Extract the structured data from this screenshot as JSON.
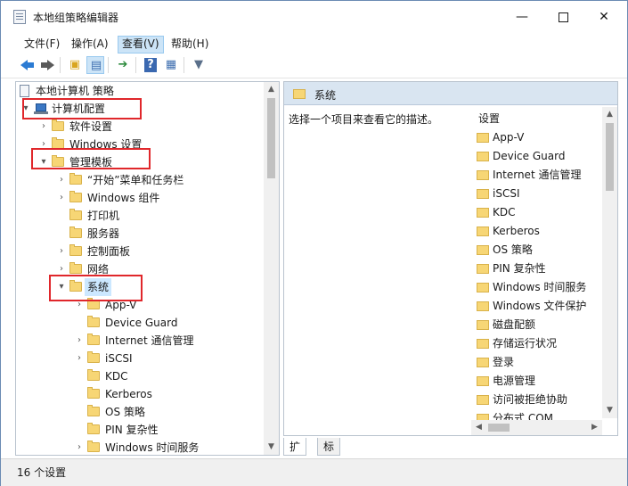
{
  "window": {
    "title": "本地组策略编辑器",
    "min_glyph": "—",
    "close_glyph": "✕"
  },
  "menu": [
    {
      "label": "文件(F)"
    },
    {
      "label": "操作(A)"
    },
    {
      "label": "查看(V)"
    },
    {
      "label": "帮助(H)"
    }
  ],
  "toolbar": {
    "icons": [
      "back-icon",
      "forward-icon",
      "up-folder-icon",
      "show-hide-tree-icon",
      "export-list-icon",
      "help-icon",
      "properties-icon",
      "filter-icon"
    ]
  },
  "tree": {
    "root": "本地计算机 策略",
    "computer_config": "计算机配置",
    "software_settings": "软件设置",
    "windows_settings": "Windows 设置",
    "admin_templates": "管理模板",
    "start_menu": "“开始”菜单和任务栏",
    "windows_components": "Windows 组件",
    "printers": "打印机",
    "server": "服务器",
    "control_panel": "控制面板",
    "network": "网络",
    "system": "系统",
    "children": [
      {
        "label": "App-V",
        "expandable": true
      },
      {
        "label": "Device Guard",
        "expandable": false
      },
      {
        "label": "Internet 通信管理",
        "expandable": true
      },
      {
        "label": "iSCSI",
        "expandable": true
      },
      {
        "label": "KDC",
        "expandable": false
      },
      {
        "label": "Kerberos",
        "expandable": false
      },
      {
        "label": "OS 策略",
        "expandable": false
      },
      {
        "label": "PIN 复杂性",
        "expandable": false
      },
      {
        "label": "Windows 时间服务",
        "expandable": true
      }
    ],
    "scroll_position": 0.0
  },
  "detail": {
    "header_title": "系统",
    "description": "选择一个项目来查看它的描述。",
    "column_header": "设置",
    "items": [
      "App-V",
      "Device Guard",
      "Internet 通信管理",
      "iSCSI",
      "KDC",
      "Kerberos",
      "OS 策略",
      "PIN 复杂性",
      "Windows 时间服务",
      "Windows 文件保护",
      "磁盘配额",
      "存储运行状况",
      "登录",
      "电源管理",
      "访问被拒绝协助",
      "分布式 COM"
    ]
  },
  "tabs": [
    {
      "label": "扩展"
    },
    {
      "label": "标准"
    }
  ],
  "status": {
    "text": "16 个设置"
  },
  "colors": {
    "highlight": "#e0272b",
    "selection": "#cce8ff",
    "header_bg": "#d9e5f1"
  }
}
